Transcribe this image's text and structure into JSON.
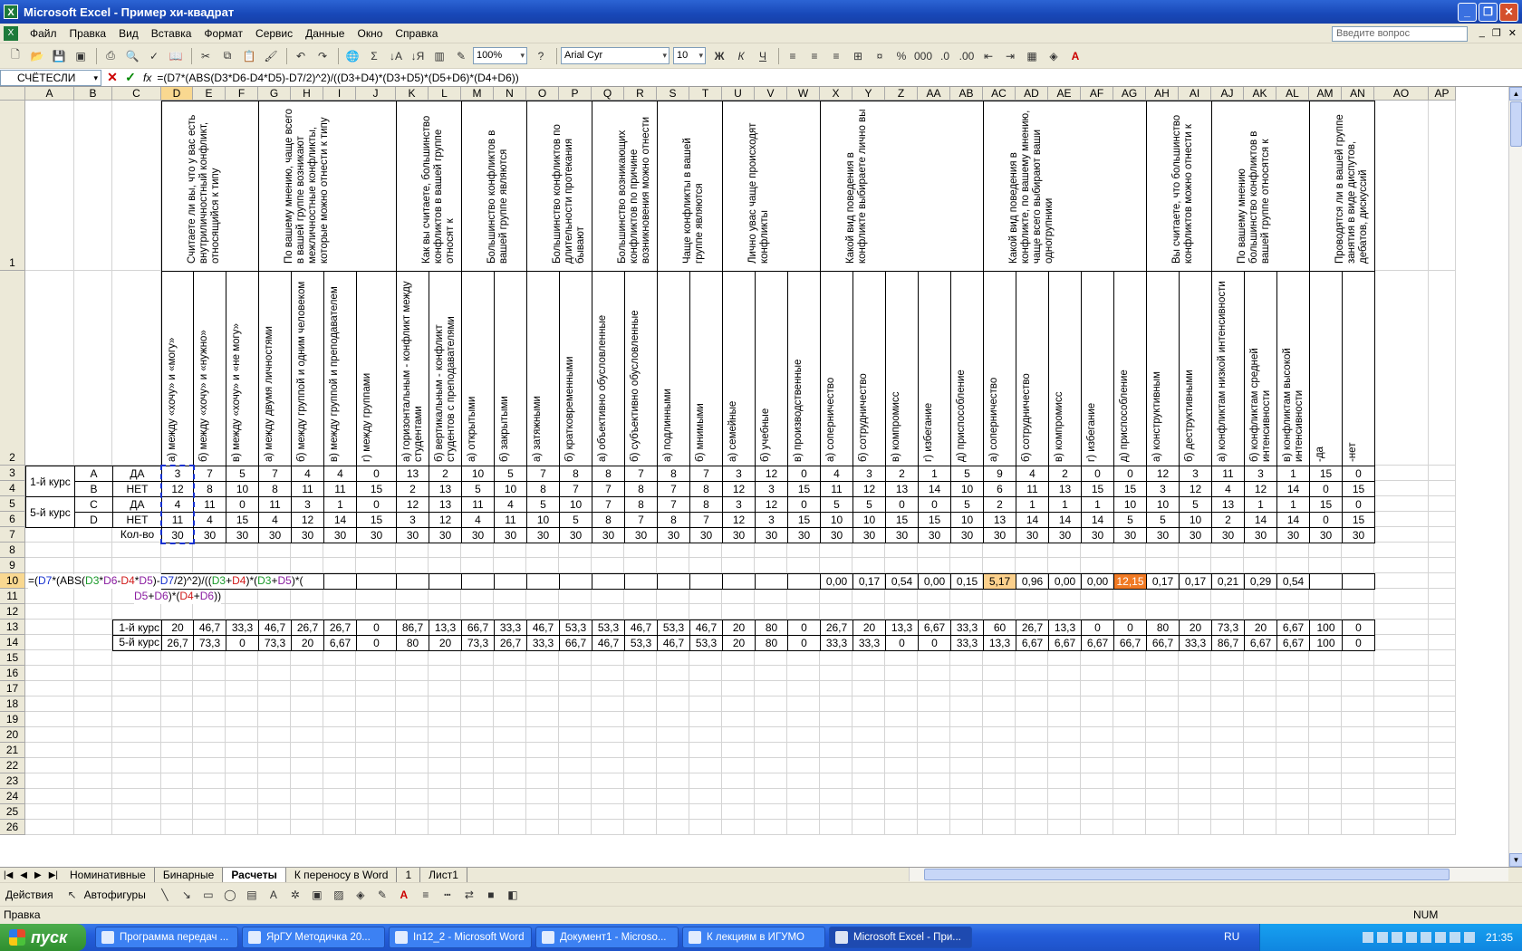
{
  "window": {
    "title": "Microsoft Excel - Пример хи-квадрат"
  },
  "menu": [
    "Файл",
    "Правка",
    "Вид",
    "Вставка",
    "Формат",
    "Сервис",
    "Данные",
    "Окно",
    "Справка"
  ],
  "help_placeholder": "Введите вопрос",
  "toolbar": {
    "zoom": "100%",
    "font": "Arial Cyr",
    "size": "10",
    "sigma": "Σ"
  },
  "formula_bar": {
    "name_box": "СЧЁТЕСЛИ",
    "fx": "fx",
    "formula": "=(D7*(ABS(D3*D6-D4*D5)-D7/2)^2)/((D3+D4)*(D3+D5)*(D5+D6)*(D4+D6))"
  },
  "columns": [
    "A",
    "B",
    "C",
    "D",
    "E",
    "F",
    "G",
    "H",
    "I",
    "J",
    "K",
    "L",
    "M",
    "N",
    "O",
    "P",
    "Q",
    "R",
    "S",
    "T",
    "U",
    "V",
    "W",
    "X",
    "Y",
    "Z",
    "AA",
    "AB",
    "AC",
    "AD",
    "AE",
    "AF",
    "AG",
    "AH",
    "AI",
    "AJ",
    "AK",
    "AL",
    "AM",
    "AN",
    "AO",
    "AP"
  ],
  "rows": [
    "1",
    "2",
    "3",
    "4",
    "5",
    "6",
    "7",
    "8",
    "9",
    "10",
    "11",
    "12",
    "13",
    "14",
    "15",
    "16",
    "17",
    "18",
    "19",
    "20",
    "21",
    "22",
    "23",
    "24",
    "25",
    "26"
  ],
  "questions": [
    "Считаете ли вы, что у вас есть внутриличностный конфликт, относящийся к типу",
    "По вашему мнению, чаще всего в вашей группе возникают межличностные конфликты, которые можно отнести к типу",
    "Как вы считаете, большинство конфликтов в вашей группе относят к",
    "Большинство конфликтов в вашей группе являются",
    "Большинство конфликтов по длительности протекания бывают",
    "Большинство возникающих конфликтов по причине возникновения можно отнести",
    "Чаще конфликты в вашей группе являются",
    "Лично увас чаще происходят конфликты",
    "Какой вид поведения в конфликте выбираете лично вы",
    "Какой вид поведения в конфликте, по вашему мнению, чаще всего выбирают ваши одногрупники",
    "Вы считаете, что большинство конфликтов можно отнести к",
    "По вашему мнению большинство конфликтов в вашей группе относятся к",
    "Проводятся ли в вашей группе занятия в виде диспутов, дебатов, дискуссий"
  ],
  "answers": [
    "а) между «хочу» и «могу»",
    "б) между «хочу» и «нужно»",
    "в) между «хочу» и «не могу»",
    "а) между двумя личностями",
    "б) между группой и одним человеком",
    "в) между группой и преподавателем",
    "г) между группами",
    "а) горизонтальным - конфликт между студентами",
    "б) вертикальным - конфликт студентов с преподавателями",
    "а) открытыми",
    "б) закрытыми",
    "а) затяжными",
    "б) кратковременными",
    "а) объективно обусловленные",
    "б) субъективно обусловленные",
    "а) подлинными",
    "б) мнимыми",
    "а) семейные",
    "б) учебные",
    "в) производственные",
    "а) соперничество",
    "б) сотрудничество",
    "в) компромисс",
    "г) избегание",
    "д) приспособление",
    "а) соперничество",
    "б) сотрудничество",
    "в) компромисс",
    "г) избегание",
    "д) приспособление",
    "а) конструктивным",
    "б) деструктивными",
    "а) конфликтам низкой интенсивности",
    "б) конфликтам средней интенсивности",
    "в) конфликтам высокой интенсивности",
    "-да",
    "-нет"
  ],
  "row_labels": {
    "course1": "1-й курс",
    "course5": "5-й курс",
    "b": [
      "A",
      "B",
      "C",
      "D"
    ],
    "c": [
      "ДА",
      "НЕТ",
      "ДА",
      "НЕТ"
    ],
    "total": "Кол-во",
    "pct1": "1-й курс",
    "pct5": "5-й курс"
  },
  "table": {
    "r3": [
      "3",
      "7",
      "5",
      "7",
      "4",
      "4",
      "0",
      "13",
      "2",
      "10",
      "5",
      "7",
      "8",
      "8",
      "7",
      "8",
      "7",
      "3",
      "12",
      "0",
      "4",
      "3",
      "2",
      "1",
      "5",
      "9",
      "4",
      "2",
      "0",
      "0",
      "12",
      "3",
      "11",
      "3",
      "1",
      "15",
      "0"
    ],
    "r4": [
      "12",
      "8",
      "10",
      "8",
      "11",
      "11",
      "15",
      "2",
      "13",
      "5",
      "10",
      "8",
      "7",
      "7",
      "8",
      "7",
      "8",
      "12",
      "3",
      "15",
      "11",
      "12",
      "13",
      "14",
      "10",
      "6",
      "11",
      "13",
      "15",
      "15",
      "3",
      "12",
      "4",
      "12",
      "14",
      "0",
      "15"
    ],
    "r5": [
      "4",
      "11",
      "0",
      "11",
      "3",
      "1",
      "0",
      "12",
      "13",
      "11",
      "4",
      "5",
      "10",
      "7",
      "8",
      "7",
      "8",
      "3",
      "12",
      "0",
      "5",
      "5",
      "0",
      "0",
      "5",
      "2",
      "1",
      "1",
      "1",
      "10",
      "10",
      "5",
      "13",
      "1",
      "1",
      "15",
      "0"
    ],
    "r6": [
      "11",
      "4",
      "15",
      "4",
      "12",
      "14",
      "15",
      "3",
      "12",
      "4",
      "11",
      "10",
      "5",
      "8",
      "7",
      "8",
      "7",
      "12",
      "3",
      "15",
      "10",
      "10",
      "15",
      "15",
      "10",
      "13",
      "14",
      "14",
      "14",
      "5",
      "5",
      "10",
      "2",
      "14",
      "14",
      "0",
      "15"
    ],
    "r7": [
      "30",
      "30",
      "30",
      "30",
      "30",
      "30",
      "30",
      "30",
      "30",
      "30",
      "30",
      "30",
      "30",
      "30",
      "30",
      "30",
      "30",
      "30",
      "30",
      "30",
      "30",
      "30",
      "30",
      "30",
      "30",
      "30",
      "30",
      "30",
      "30",
      "30",
      "30",
      "30",
      "30",
      "30",
      "30",
      "30",
      "30"
    ],
    "r10": [
      "",
      "",
      "",
      "",
      "",
      "",
      "",
      "",
      "",
      "",
      "",
      "",
      "",
      "",
      "",
      "",
      "",
      "",
      "",
      "",
      "0,00",
      "0,17",
      "0,54",
      "0,00",
      "0,15",
      "5,17",
      "0,96",
      "0,00",
      "0,00",
      "12,15",
      "0,17",
      "0,17",
      "0,21",
      "0,29",
      "0,54",
      "",
      ""
    ],
    "r13": [
      "20",
      "46,7",
      "33,3",
      "46,7",
      "26,7",
      "26,7",
      "0",
      "86,7",
      "13,3",
      "66,7",
      "33,3",
      "46,7",
      "53,3",
      "53,3",
      "46,7",
      "53,3",
      "46,7",
      "20",
      "80",
      "0",
      "26,7",
      "20",
      "13,3",
      "6,67",
      "33,3",
      "60",
      "26,7",
      "13,3",
      "0",
      "0",
      "80",
      "20",
      "73,3",
      "20",
      "6,67",
      "100",
      "0"
    ],
    "r14": [
      "26,7",
      "73,3",
      "0",
      "73,3",
      "20",
      "6,67",
      "0",
      "80",
      "20",
      "73,3",
      "26,7",
      "33,3",
      "66,7",
      "46,7",
      "53,3",
      "46,7",
      "53,3",
      "20",
      "80",
      "0",
      "33,3",
      "33,3",
      "0",
      "0",
      "33,3",
      "13,3",
      "6,67",
      "6,67",
      "6,67",
      "66,7",
      "66,7",
      "33,3",
      "86,7",
      "6,67",
      "6,67",
      "100",
      "0"
    ]
  },
  "cell_edit": {
    "line1": [
      "=(",
      "D7",
      "*(ABS(",
      "D3",
      "*",
      "D6",
      "-",
      "D4",
      "*",
      "D5",
      ")-",
      "D7",
      "/2)^2)/((",
      "D3",
      "+",
      "D4",
      ")*(",
      "D3",
      "+",
      "D5",
      ")*("
    ],
    "line2": [
      "D5",
      "+",
      "D6",
      ")*(",
      "D4",
      "+",
      "D6",
      "))"
    ]
  },
  "sheet_tabs": [
    "Номинативные",
    "Бинарные",
    "Расчеты",
    "К переносу в Word",
    "1",
    "Лист1"
  ],
  "active_tab": "Расчеты",
  "draw_toolbar": {
    "actions": "Действия",
    "autoshapes": "Автофигуры"
  },
  "status": {
    "left": "Правка",
    "num": "NUM"
  },
  "taskbar": {
    "start": "пуск",
    "tasks": [
      "Программа передач ...",
      "ЯрГУ Методичка 20...",
      "In12_2 - Microsoft Word",
      "Документ1 - Microso...",
      "К лекциям в ИГУМО",
      "Microsoft Excel - При..."
    ],
    "lang": "RU",
    "clock": "21:35"
  },
  "colors": {
    "highlight_light": "#fbd08c",
    "highlight_dark": "#f07a24",
    "xp_blue": "#245edb"
  }
}
